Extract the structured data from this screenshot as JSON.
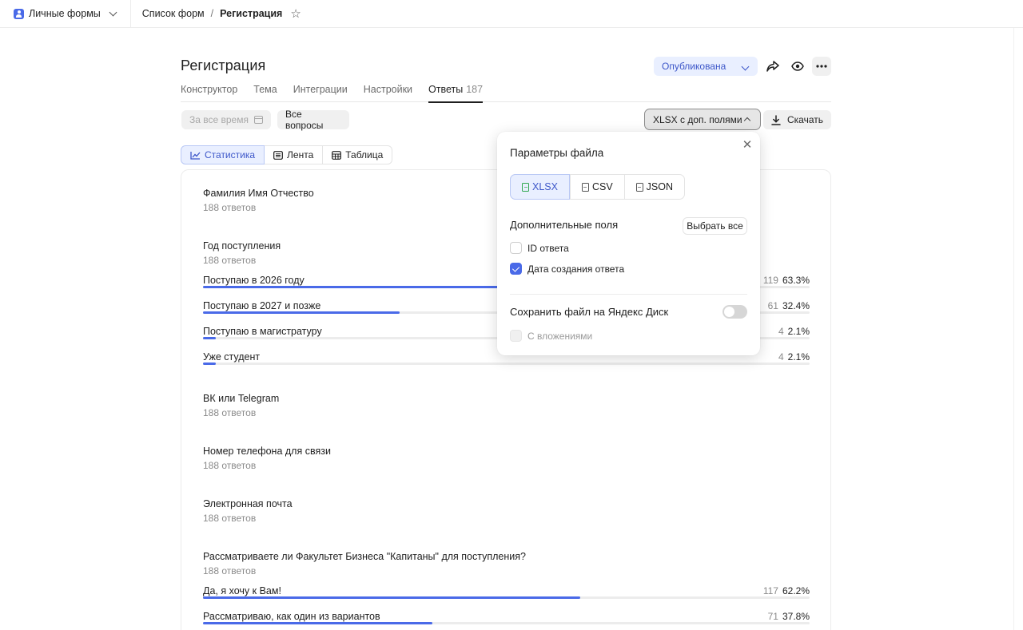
{
  "topbar": {
    "workspace": "Личные формы",
    "crumbs": {
      "list": "Список форм",
      "sep": "/",
      "current": "Регистрация"
    }
  },
  "form": {
    "title": "Регистрация",
    "status": "Опубликована"
  },
  "tabs": [
    {
      "label": "Конструктор"
    },
    {
      "label": "Тема"
    },
    {
      "label": "Интеграции"
    },
    {
      "label": "Настройки"
    },
    {
      "label": "Ответы",
      "count": "187",
      "active": true
    }
  ],
  "filters": {
    "period_placeholder": "За все время",
    "questions": "Все вопросы",
    "format": "XLSX с доп. полями",
    "download": "Скачать"
  },
  "views": [
    {
      "label": "Статистика",
      "icon": "chart-icon",
      "active": true
    },
    {
      "label": "Лента",
      "icon": "list-icon"
    },
    {
      "label": "Таблица",
      "icon": "table-icon"
    }
  ],
  "questions": [
    {
      "title": "Фамилия Имя Отчество",
      "sub": "188 ответов",
      "options": []
    },
    {
      "title": "Год поступления",
      "sub": "188 ответов",
      "options": [
        {
          "label": "Поступаю в 2026 году",
          "count": "119",
          "percent": "63.3%",
          "share": 0.633
        },
        {
          "label": "Поступаю в 2027 и позже",
          "count": "61",
          "percent": "32.4%",
          "share": 0.324
        },
        {
          "label": "Поступаю в магистратуру",
          "count": "4",
          "percent": "2.1%",
          "share": 0.021
        },
        {
          "label": "Уже студент",
          "count": "4",
          "percent": "2.1%",
          "share": 0.021
        }
      ]
    },
    {
      "title": "ВК или Telegram",
      "sub": "188 ответов",
      "options": []
    },
    {
      "title": "Номер телефона для связи",
      "sub": "188 ответов",
      "options": []
    },
    {
      "title": "Электронная почта",
      "sub": "188 ответов",
      "options": []
    },
    {
      "title": "Рассматриваете ли Факультет Бизнеса \"Капитаны\" для поступления?",
      "sub": "188 ответов",
      "options": [
        {
          "label": "Да, я хочу к Вам!",
          "count": "117",
          "percent": "62.2%",
          "share": 0.622
        },
        {
          "label": "Рассматриваю, как один из вариантов",
          "count": "71",
          "percent": "37.8%",
          "share": 0.378
        }
      ]
    }
  ],
  "popup": {
    "title": "Параметры файла",
    "formats": [
      {
        "label": "XLSX",
        "active": true
      },
      {
        "label": "CSV"
      },
      {
        "label": "JSON"
      }
    ],
    "extra_title": "Дополнительные поля",
    "select_all": "Выбрать все",
    "fields": [
      {
        "label": "ID ответа",
        "checked": false
      },
      {
        "label": "Дата создания ответа",
        "checked": true
      }
    ],
    "disk_title": "Сохранить файл на Яндекс Диск",
    "disk_enabled": false,
    "attachments": "С вложениями"
  },
  "colors": {
    "accent": "#4a6ae8",
    "accent_bg": "#e9efff",
    "xlsx_green": "#2fa84f"
  }
}
